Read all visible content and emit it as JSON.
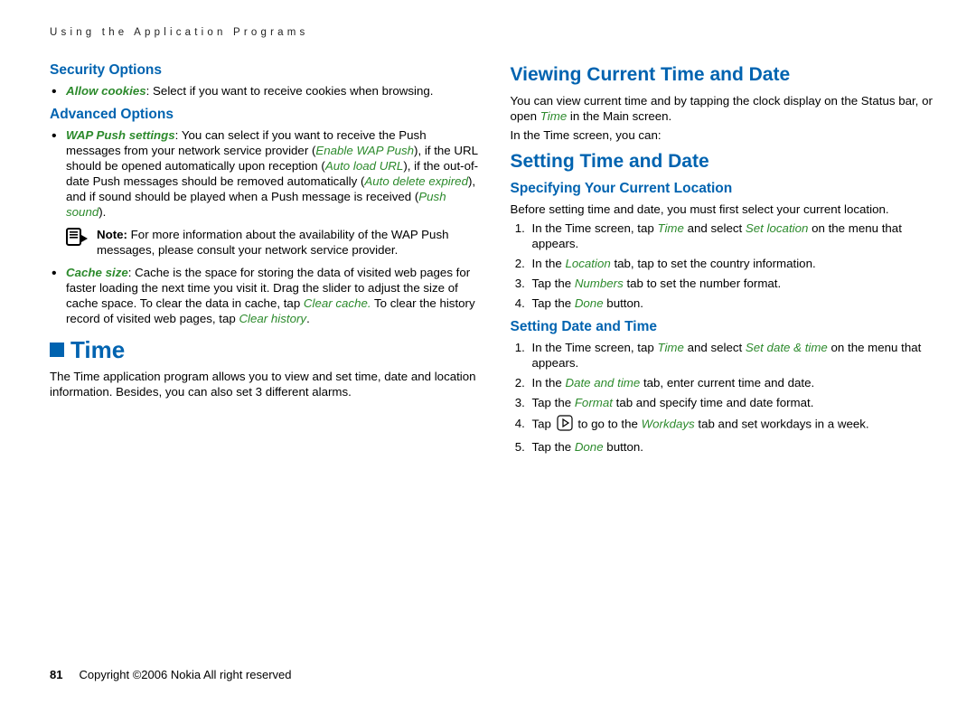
{
  "runningHead": "Using the Application Programs",
  "left": {
    "security": {
      "heading": "Security Options",
      "cookies_label": "Allow cookies",
      "cookies_rest": ": Select if you want to receive cookies when browsing."
    },
    "advanced": {
      "heading": "Advanced Options",
      "wap_label": "WAP Push settings",
      "wap_t1": ": You can select if you want to receive the Push messages from your network service provider (",
      "wap_e1": "Enable WAP Push",
      "wap_t2": "), if the URL should be opened automatically upon reception (",
      "wap_e2": "Auto load URL",
      "wap_t3": "), if the out-of-date Push messages should be removed automatically (",
      "wap_e3": "Auto delete expired",
      "wap_t4": "), and if sound should be played when a Push message is received (",
      "wap_e4": "Push sound",
      "wap_t5": ").",
      "note_bold": "Note:",
      "note_text": " For more information about the availability of the WAP Push messages, please consult your network service provider.",
      "cache_label": "Cache size",
      "cache_t1": ": Cache is the space for storing the data of visited web pages for faster loading the next time you visit it. Drag the slider to adjust the size of cache space. To clear the data in cache, tap ",
      "cache_e1": "Clear cache.",
      "cache_t2": " To clear the history record of visited web pages, tap ",
      "cache_e2": "Clear history",
      "cache_t3": "."
    },
    "time": {
      "heading": "Time",
      "intro": "The Time application program allows you to view and set time, date and location information. Besides, you can also set 3 different alarms."
    }
  },
  "right": {
    "viewing": {
      "heading": "Viewing Current Time and Date",
      "p1a": "You can view current time and by tapping the clock display on the Status bar, or open ",
      "p1e": "Time",
      "p1b": " in the Main screen.",
      "p2": "In the Time screen, you can:"
    },
    "setting": {
      "heading": "Setting Time and Date",
      "loc": {
        "heading": "Specifying Your Current Location",
        "intro": "Before setting time and date, you must first select your current location.",
        "s1a": "In the Time screen, tap ",
        "s1e1": "Time",
        "s1b": " and select ",
        "s1e2": "Set location",
        "s1c": " on the menu that appears.",
        "s2a": "In the ",
        "s2e": "Location",
        "s2b": " tab, tap to set the country information.",
        "s3a": "Tap the ",
        "s3e": "Numbers",
        "s3b": " tab to set the number format.",
        "s4a": "Tap the ",
        "s4e": "Done",
        "s4b": " button."
      },
      "dt": {
        "heading": "Setting Date and Time",
        "s1a": "In the Time screen, tap ",
        "s1e1": "Time",
        "s1b": " and select ",
        "s1e2": "Set date & time",
        "s1c": " on the menu that appears.",
        "s2a": "In the ",
        "s2e": "Date and time",
        "s2b": " tab, enter current time and date.",
        "s3a": "Tap the ",
        "s3e": "Format",
        "s3b": " tab and specify time and date format.",
        "s4a": "Tap ",
        "s4b": " to go to the ",
        "s4e": "Workdays",
        "s4c": " tab and set workdays in a week.",
        "s5a": "Tap the ",
        "s5e": "Done",
        "s5b": " button."
      }
    }
  },
  "footer": {
    "pageNum": "81",
    "copy": "Copyright ©2006 Nokia All right reserved"
  }
}
